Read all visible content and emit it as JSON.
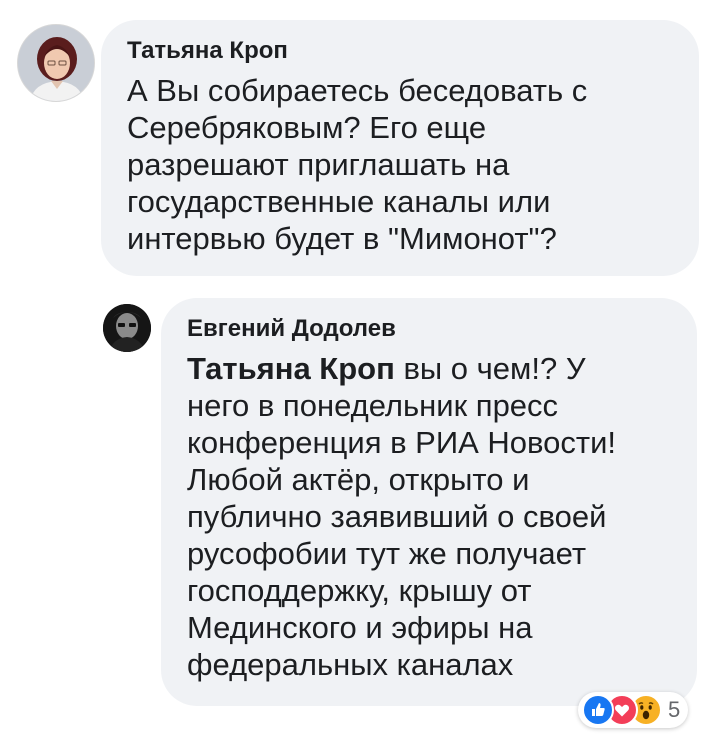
{
  "comments": [
    {
      "author": "Татьяна Кроп",
      "text": "А Вы собираетесь беседовать с\nСеребряковым? Его еще\nразрешают приглашать на\nгосударственные каналы или\nинтервью будет в \"Мимонот\"?",
      "avatar_icon": "user-avatar-photo"
    },
    {
      "author": "Евгений Додолев",
      "mention": "Татьяна Кроп",
      "text": " вы о чем!? У\nнего в понедельник пресс\nконференция в РИА Новости!\nЛюбой актёр, открыто и\nпублично заявивший о своей\nрусофобии тут же получает\nгосподдержку, крышу от\nМединского и эфиры на\nфедеральных каналах",
      "avatar_icon": "user-avatar-photo"
    }
  ],
  "reactions": {
    "types": [
      "like-icon",
      "love-icon",
      "wow-icon"
    ],
    "count": "5"
  },
  "colors": {
    "bubble": "#f0f2f5",
    "text": "#1c1e21",
    "like": "#1877f2",
    "love": "#f33e58",
    "wow": "#f7b125",
    "muted": "#65676b"
  }
}
